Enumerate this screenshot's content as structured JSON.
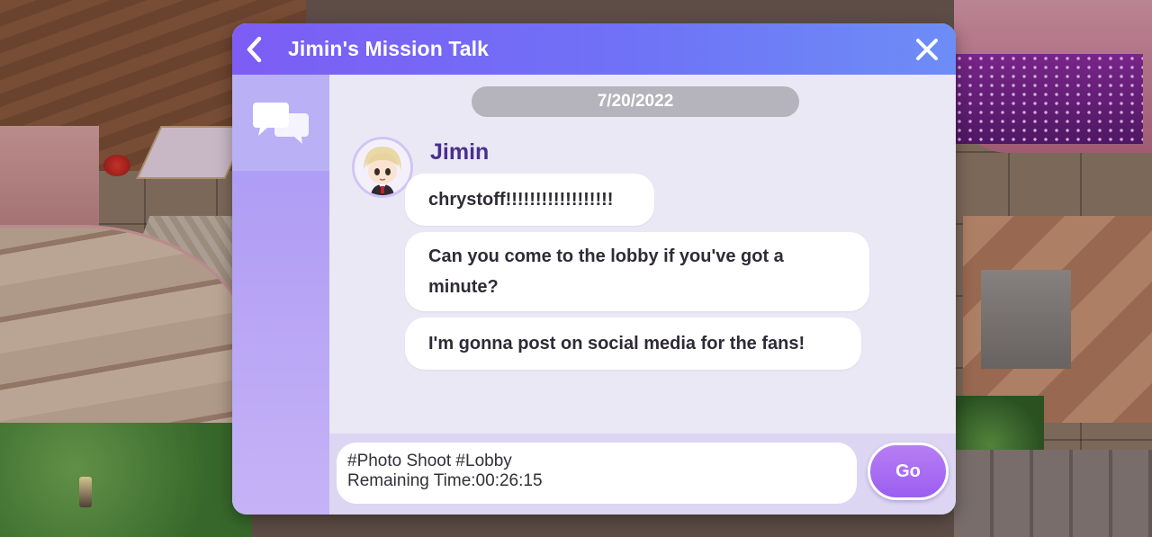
{
  "dialog": {
    "title": "Jimin's Mission Talk",
    "back_icon": "chevron-left-icon",
    "close_icon": "close-icon"
  },
  "sidebar": {
    "tabs": [
      {
        "icon": "chat-bubbles-icon",
        "active": true
      }
    ]
  },
  "chat": {
    "date": "7/20/2022",
    "sender": {
      "name": "Jimin",
      "avatar_icon": "character-avatar"
    },
    "messages": [
      {
        "text": "chrystoff!!!!!!!!!!!!!!!!!!"
      },
      {
        "text": "Can you come to the lobby if you've got a minute?"
      },
      {
        "text": "I'm gonna post on social media for the fans!"
      }
    ]
  },
  "mission": {
    "tags": "#Photo Shoot #Lobby",
    "remaining_time": "Remaining Time:00:26:15",
    "go_label": "Go"
  },
  "colors": {
    "header_start": "#7d5df5",
    "header_end": "#6d8df6",
    "sender_name": "#4a2f8e",
    "go_button": "#9b5ef0"
  }
}
